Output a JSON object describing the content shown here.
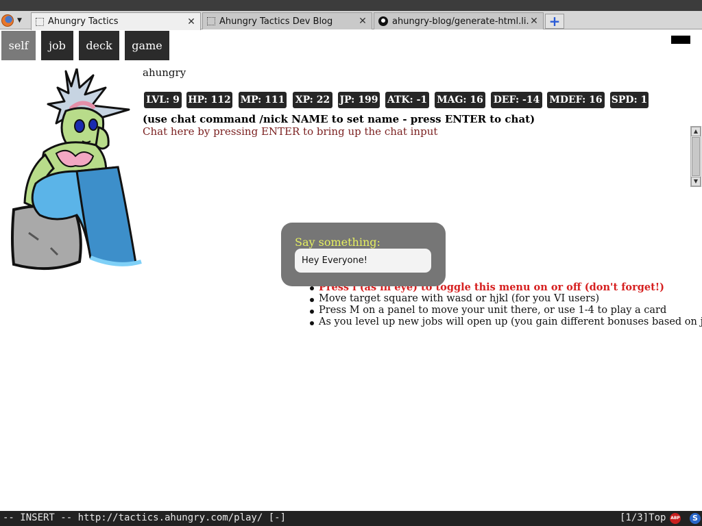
{
  "browser": {
    "tabs": [
      {
        "title": "Ahungry Tactics",
        "active": true,
        "icon": "blank-page-icon"
      },
      {
        "title": "Ahungry Tactics Dev Blog",
        "active": false,
        "icon": "blank-page-icon"
      },
      {
        "title": "ahungry-blog/generate-html.li...",
        "active": false,
        "icon": "github-icon"
      }
    ],
    "new_tab_symbol": "+",
    "close_symbol": "✕",
    "menu_arrow": "▼"
  },
  "nav": {
    "items": [
      {
        "label": "self",
        "active": true
      },
      {
        "label": "job",
        "active": false
      },
      {
        "label": "deck",
        "active": false
      },
      {
        "label": "game",
        "active": false
      }
    ]
  },
  "player": {
    "name": "ahungry"
  },
  "stats": [
    {
      "label": "LVL: 9"
    },
    {
      "label": "HP: 112"
    },
    {
      "label": "MP: 111"
    },
    {
      "label": "XP: 22"
    },
    {
      "label": "JP: 199"
    },
    {
      "label": "ATK: -1"
    },
    {
      "label": "MAG: 16"
    },
    {
      "label": "DEF: -14"
    },
    {
      "label": "MDEF: 16"
    },
    {
      "label": "SPD: 1"
    }
  ],
  "chat": {
    "hint": "(use chat command /nick NAME to set name - press ENTER to chat)",
    "prompt": "Chat here by pressing ENTER to bring up the chat input",
    "say_label": "Say something:",
    "input_value": "Hey Everyone!"
  },
  "tips": [
    {
      "text": "Press i (as in eye) to toggle this menu on or off (don't forget!)",
      "highlight": true
    },
    {
      "text": "Move target square with wasd or hjkl (for you VI users)",
      "highlight": false
    },
    {
      "text": "Press M on a panel to move your unit there, or use 1-4 to play a card",
      "highlight": false
    },
    {
      "text": "As you level up new jobs will open up (you gain different bonuses based on job!)",
      "highlight": false
    }
  ],
  "statusbar": {
    "left": "-- INSERT -- http://tactics.ahungry.com/play/ [-]",
    "position": "[1/3]Top",
    "adblock_label": "ABP",
    "extension_label": "S"
  },
  "colors": {
    "nav_bg": "#2b2b2b",
    "nav_active_bg": "#7a7a7a",
    "stat_bg": "#262626",
    "hint_tip": "#d62020",
    "chat_prompt": "#7a1f1f",
    "say_label": "#e6f060",
    "say_box_bg": "#767676"
  }
}
